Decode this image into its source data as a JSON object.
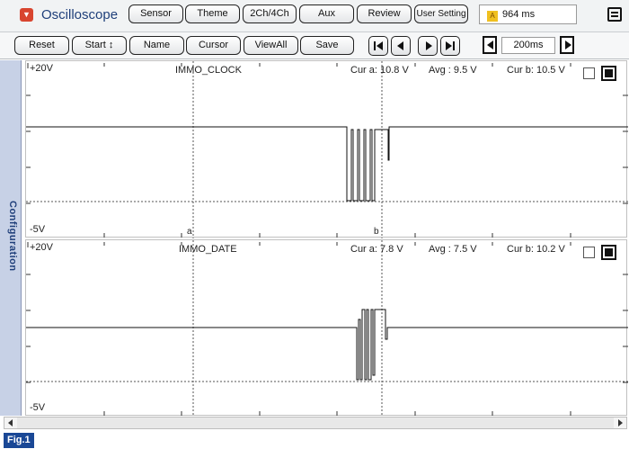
{
  "header": {
    "title": "Oscilloscope",
    "buttons": [
      "Sensor",
      "Theme",
      "2Ch/4Ch",
      "Aux",
      "Review",
      "User Setting"
    ],
    "elapsed": "964 ms"
  },
  "toolbar": {
    "reset": "Reset",
    "start": "Start ↕",
    "name": "Name",
    "cursor": "Cursor",
    "view_all": "ViewAll",
    "save": "Save",
    "timebase": "200ms"
  },
  "sidebar": {
    "label": "Configuration"
  },
  "channels": [
    {
      "name": "IMMO_CLOCK",
      "vmax": "+20V",
      "vmin": "-5V",
      "cur_a": "Cur a: 10.8 V",
      "avg": "Avg : 9.5 V",
      "cur_b": "Cur b: 10.5 V",
      "marker_a": "a",
      "marker_b": "b"
    },
    {
      "name": "IMMO_DATE",
      "vmax": "+20V",
      "vmin": "-5V",
      "cur_a": "Cur a: 7.8 V",
      "avg": "Avg : 7.5 V",
      "cur_b": "Cur b: 10.2 V"
    }
  ],
  "figure_label": "Fig.1",
  "colors": {
    "title": "#1f3f7a",
    "sidetab": "#c7d1e6",
    "fig_badge": "#1a4896",
    "app_icon": "#d8452f"
  }
}
